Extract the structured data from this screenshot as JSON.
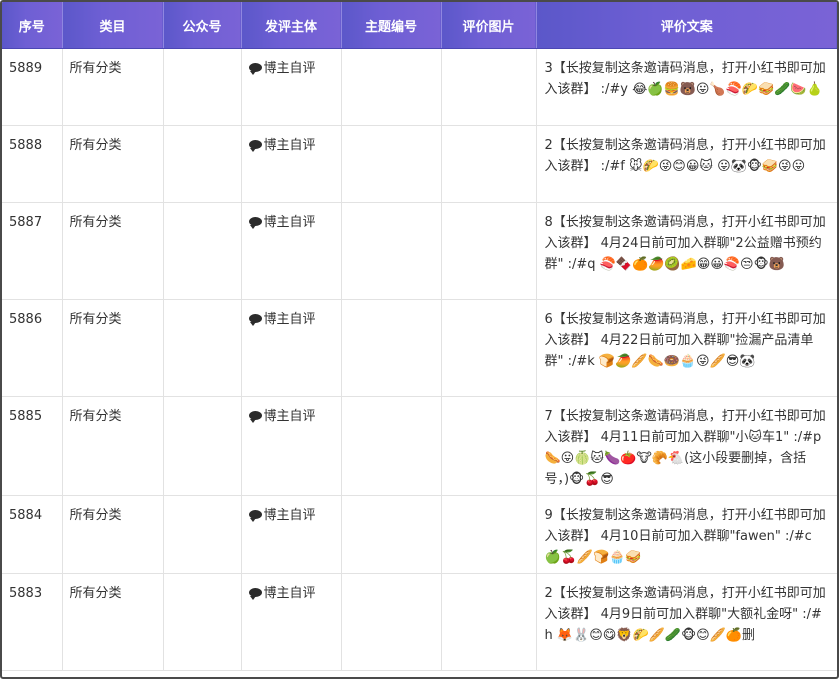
{
  "header": {
    "col_index": "序号",
    "col_category": "类目",
    "col_account": "公众号",
    "col_author": "发评主体",
    "col_topic": "主题编号",
    "col_image": "评价图片",
    "col_text": "评价文案"
  },
  "rows": [
    {
      "id": "5889",
      "category": "所有分类",
      "account": "",
      "author": "博主自评",
      "topic": "",
      "image": "",
      "text": "3【长按复制这条邀请码消息，打开小红书即可加入该群】 :/#y 😂🍏🍔🐻😛🍗🍣🌮🥪🥒🍉🍐"
    },
    {
      "id": "5888",
      "category": "所有分类",
      "account": "",
      "author": "博主自评",
      "topic": "",
      "image": "",
      "text": "2【长按复制这条邀请码消息，打开小红书即可加入该群】 :/#f 🐭🌮😜😊😀🐱 😛🐼🐵🥪😜😛"
    },
    {
      "id": "5887",
      "category": "所有分类",
      "account": "",
      "author": "博主自评",
      "topic": "",
      "image": "",
      "text": "8【长按复制这条邀请码消息，打开小红书即可加入该群】 4月24日前可加入群聊\"2公益赠书预约群\" :/#q 🍣🍫🍊🥭🥝🧀😁😀🍣😒🐵🐻"
    },
    {
      "id": "5886",
      "category": "所有分类",
      "account": "",
      "author": "博主自评",
      "topic": "",
      "image": "",
      "text": "6【长按复制这条邀请码消息，打开小红书即可加入该群】 4月22日前可加入群聊\"捡漏产品清单群\" :/#k 🍞🥭🥖🌭🍩🧁😜🥖😎🐼"
    },
    {
      "id": "5885",
      "category": "所有分类",
      "account": "",
      "author": "博主自评",
      "topic": "",
      "image": "",
      "text": "7【长按复制这条邀请码消息，打开小红书即可加入该群】 4月11日前可加入群聊\"小🐱车1\" :/#p 🌭😛🍈🐱🍆🍅🐮🥐🐔(这小段要删掉，含括号，)🐵🍒😎"
    },
    {
      "id": "5884",
      "category": "所有分类",
      "account": "",
      "author": "博主自评",
      "topic": "",
      "image": "",
      "text": "9【长按复制这条邀请码消息，打开小红书即可加入该群】 4月10日前可加入群聊\"fawen\" :/#c 🍏🍒🥖🍞🧁🥪"
    },
    {
      "id": "5883",
      "category": "所有分类",
      "account": "",
      "author": "博主自评",
      "topic": "",
      "image": "",
      "text": "2【长按复制这条邀请码消息，打开小红书即可加入该群】 4月9日前可加入群聊\"大额礼金呀\" :/#h 🦊🐰😊😋🦁🌮🥖🥒🐵😊🥖🍊删"
    }
  ]
}
